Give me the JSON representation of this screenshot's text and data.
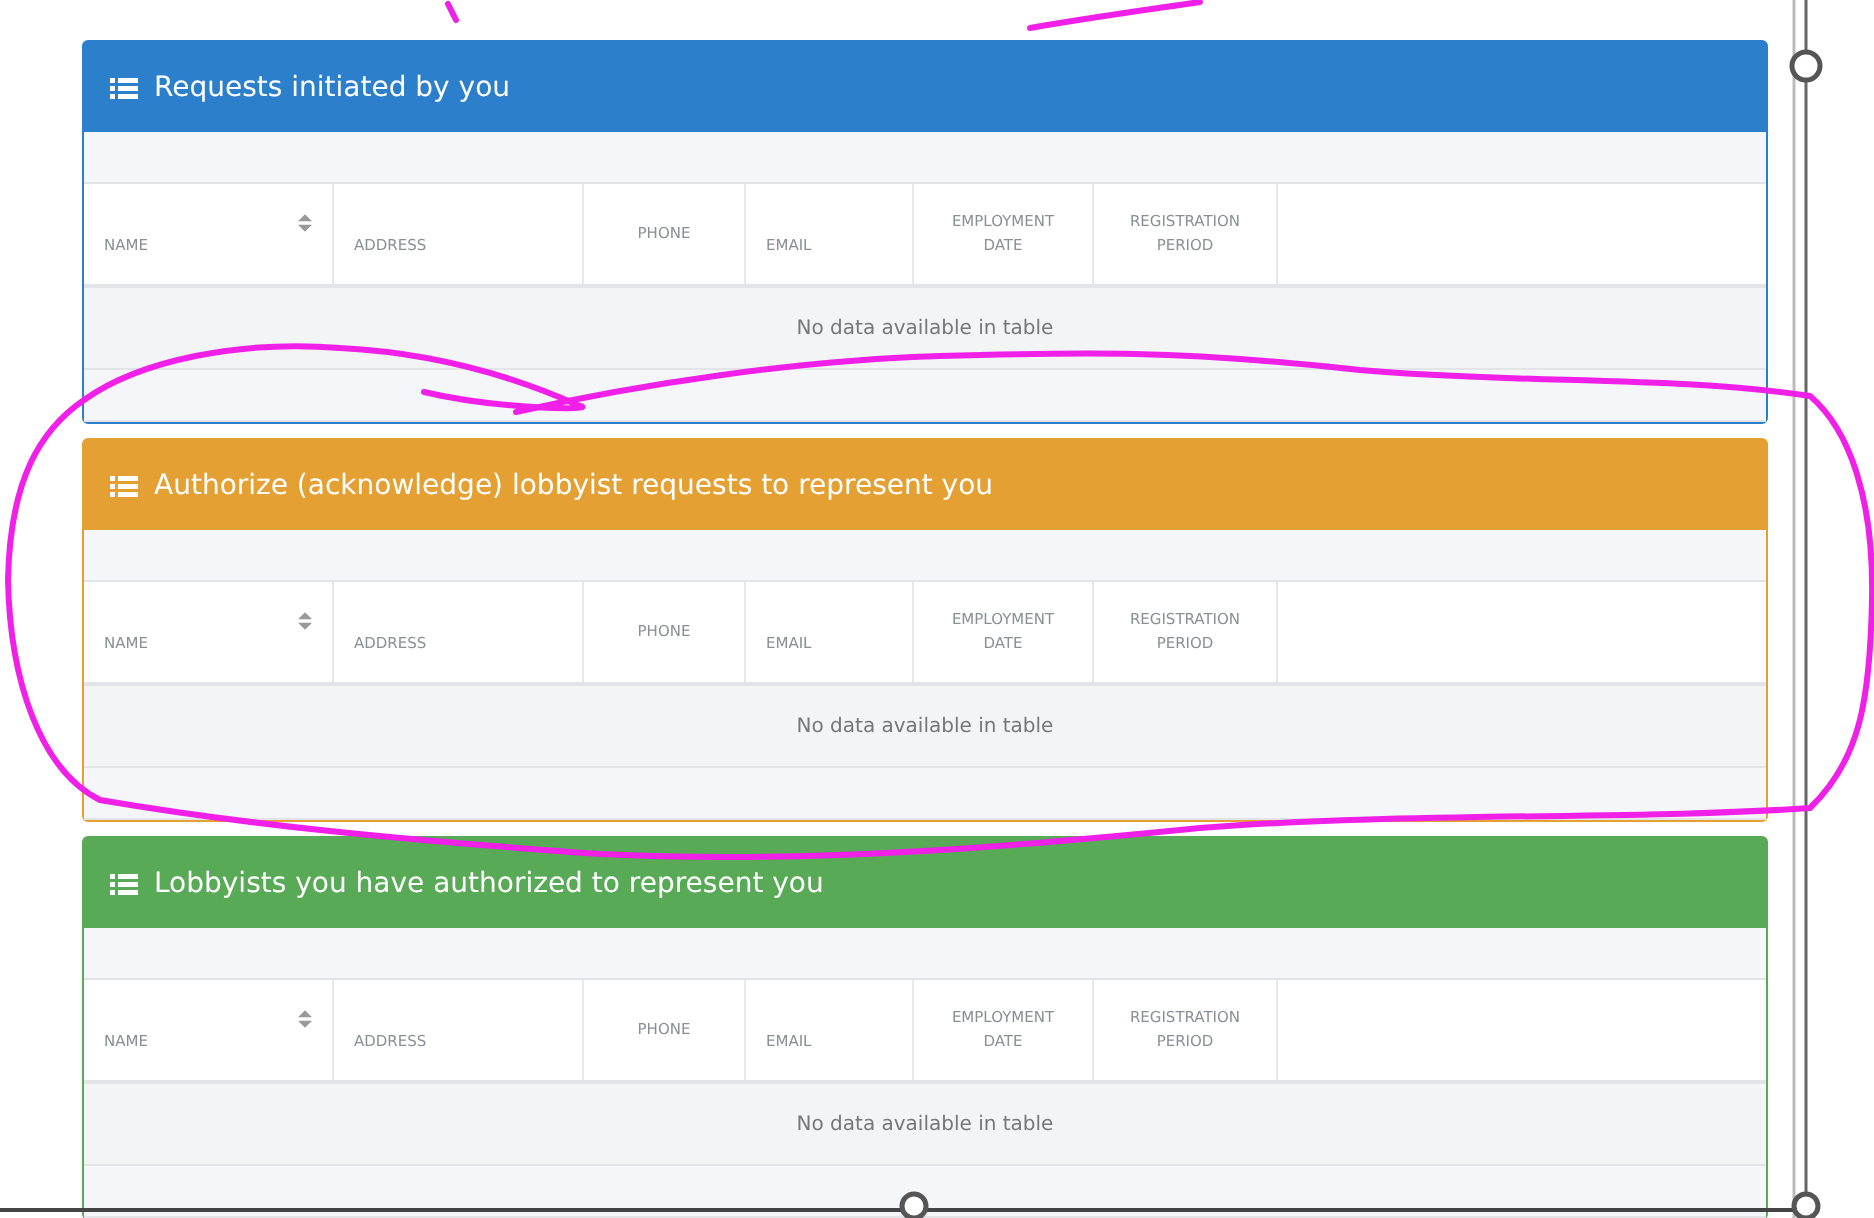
{
  "panels": [
    {
      "title": "Requests initiated by you",
      "color": "#2b7fcb",
      "columns": [
        {
          "label": "NAME",
          "sortable": true
        },
        {
          "label": "ADDRESS",
          "sortable": false
        },
        {
          "label": "PHONE",
          "sortable": false
        },
        {
          "label": "EMAIL",
          "sortable": false
        },
        {
          "label": "EMPLOYMENT DATE",
          "sortable": false
        },
        {
          "label": "REGISTRATION PERIOD",
          "sortable": false
        }
      ],
      "empty_message": "No data available in table"
    },
    {
      "title": "Authorize (acknowledge) lobbyist requests to represent you",
      "color": "#e5a033",
      "columns": [
        {
          "label": "NAME",
          "sortable": true
        },
        {
          "label": "ADDRESS",
          "sortable": false
        },
        {
          "label": "PHONE",
          "sortable": false
        },
        {
          "label": "EMAIL",
          "sortable": false
        },
        {
          "label": "EMPLOYMENT DATE",
          "sortable": false
        },
        {
          "label": "REGISTRATION PERIOD",
          "sortable": false
        }
      ],
      "empty_message": "No data available in table"
    },
    {
      "title": "Lobbyists you have authorized to represent you",
      "color": "#58aa57",
      "columns": [
        {
          "label": "NAME",
          "sortable": true
        },
        {
          "label": "ADDRESS",
          "sortable": false
        },
        {
          "label": "PHONE",
          "sortable": false
        },
        {
          "label": "EMAIL",
          "sortable": false
        },
        {
          "label": "EMPLOYMENT DATE",
          "sortable": false
        },
        {
          "label": "REGISTRATION PERIOD",
          "sortable": false
        }
      ],
      "empty_message": "No data available in table"
    }
  ]
}
